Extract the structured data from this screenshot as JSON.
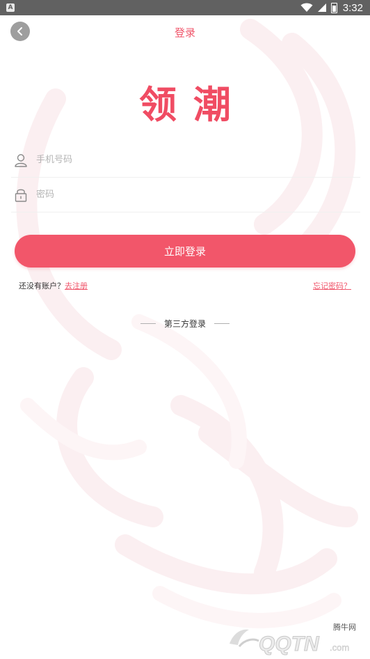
{
  "status_bar": {
    "notification_icon": "a-notification-icon",
    "time": "3:32"
  },
  "header": {
    "title": "登录",
    "back_icon": "chevron-left-icon"
  },
  "logo": {
    "text": "领潮"
  },
  "form": {
    "phone": {
      "placeholder": "手机号码",
      "value": "",
      "icon": "user-icon"
    },
    "password": {
      "placeholder": "密码",
      "value": "",
      "icon": "lock-icon"
    }
  },
  "login_button": {
    "label": "立即登录"
  },
  "links": {
    "no_account_text": "还没有账户？",
    "register_label": "去注册",
    "forgot_label": "忘记密码？"
  },
  "third_party": {
    "label": "第三方登录"
  },
  "watermark": {
    "site_cn": "腾牛网",
    "site_logo": "QQTN.com"
  },
  "colors": {
    "accent": "#f2566a",
    "status_bar": "#616161",
    "back_button": "#9e9e9e"
  }
}
